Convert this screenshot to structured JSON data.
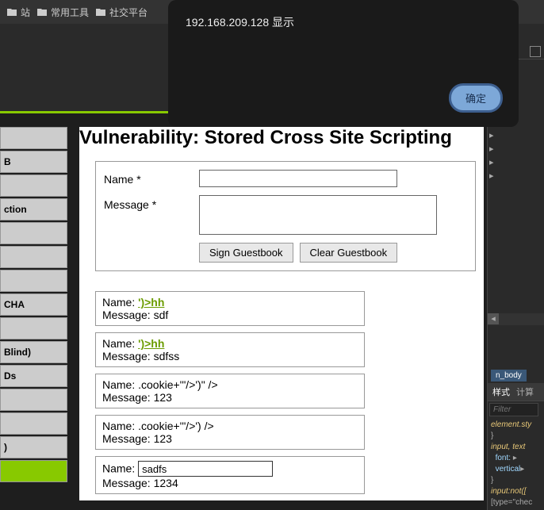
{
  "bookmarks": [
    {
      "icon": "folder",
      "label": "站"
    },
    {
      "icon": "folder",
      "label": "常用工具"
    },
    {
      "icon": "folder",
      "label": "社交平台"
    }
  ],
  "modal": {
    "title": "192.168.209.128 显示",
    "ok": "确定"
  },
  "sidebar": {
    "items": [
      "",
      "B",
      "",
      "ction",
      "",
      "",
      "",
      "CHA",
      "",
      "Blind)",
      "Ds",
      "",
      "",
      ")",
      ""
    ],
    "active_index": 14
  },
  "page": {
    "title": "Vulnerability: Stored Cross Site Scripting",
    "form": {
      "name_label": "Name *",
      "message_label": "Message *",
      "sign_btn": "Sign Guestbook",
      "clear_btn": "Clear Guestbook"
    }
  },
  "entries": [
    {
      "name_prefix": "Name: ",
      "name_link": "')>hh",
      "message": "Message: sdf"
    },
    {
      "name_prefix": "Name: ",
      "name_link": "')>hh",
      "message": "Message: sdfss"
    },
    {
      "name_raw": "Name: .cookie+'\"/>')\" />",
      "message": "Message: 123"
    },
    {
      "name_raw": "Name: .cookie+'\"/>') />",
      "message": "Message: 123"
    },
    {
      "name_prefix": "Name: ",
      "input_value": "sadfs",
      "message": "Message: 1234"
    }
  ],
  "devtools": {
    "body_tab": "n_body",
    "tabs": [
      "样式",
      "计算"
    ],
    "filter_placeholder": "Filter",
    "code_lines": [
      "element.sty",
      "}",
      "input, text",
      "font: ",
      "vertical",
      "}",
      "input:not([",
      "[type=\"chec"
    ]
  }
}
